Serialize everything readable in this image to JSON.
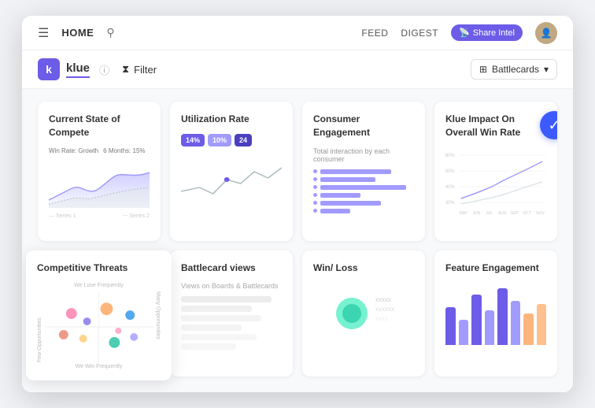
{
  "nav": {
    "hamburger": "☰",
    "home_label": "HOME",
    "search_icon": "🔍",
    "feed_label": "FEED",
    "digest_label": "DIGEST",
    "share_intel_label": "Share Intel",
    "avatar_initial": "👤"
  },
  "toolbar": {
    "logo_letter": "k",
    "app_name": "klue",
    "info_icon": "ⓘ",
    "filter_label": "Filter",
    "battlecards_label": "Battlecards",
    "chevron": "▾"
  },
  "cards": {
    "current_state": {
      "title": "Current State of Compete",
      "stat1": "Win Rate: Growth",
      "stat2": "6 Months: 15%"
    },
    "utilization": {
      "title": "Utilization Rate",
      "badge1": "14%",
      "badge2": "10%",
      "badge3": "24"
    },
    "consumer": {
      "title": "Consumer Engagement",
      "subtitle": "Total interaction by each consumer"
    },
    "klue_impact": {
      "title": "Klue Impact On Overall Win Rate"
    },
    "competitive": {
      "title": "Competitive Threats",
      "top_label": "We Lose Frequently",
      "bottom_label": "We Win Frequently",
      "left_label": "Few Opportunities",
      "right_label": "Many Opportunities"
    },
    "battlecard": {
      "title": "Battlecard views",
      "subtitle": "Views on Boards & Battlecards"
    },
    "win_loss": {
      "title": "Win/ Loss"
    },
    "feature": {
      "title": "Feature Engagement"
    }
  },
  "colors": {
    "purple": "#6c5ce7",
    "light_purple": "#a29bfe",
    "blue": "#3d5afe",
    "teal": "#55efc4",
    "orange": "#fd9644",
    "pink": "#fd79a8",
    "mint": "#00cec9"
  }
}
